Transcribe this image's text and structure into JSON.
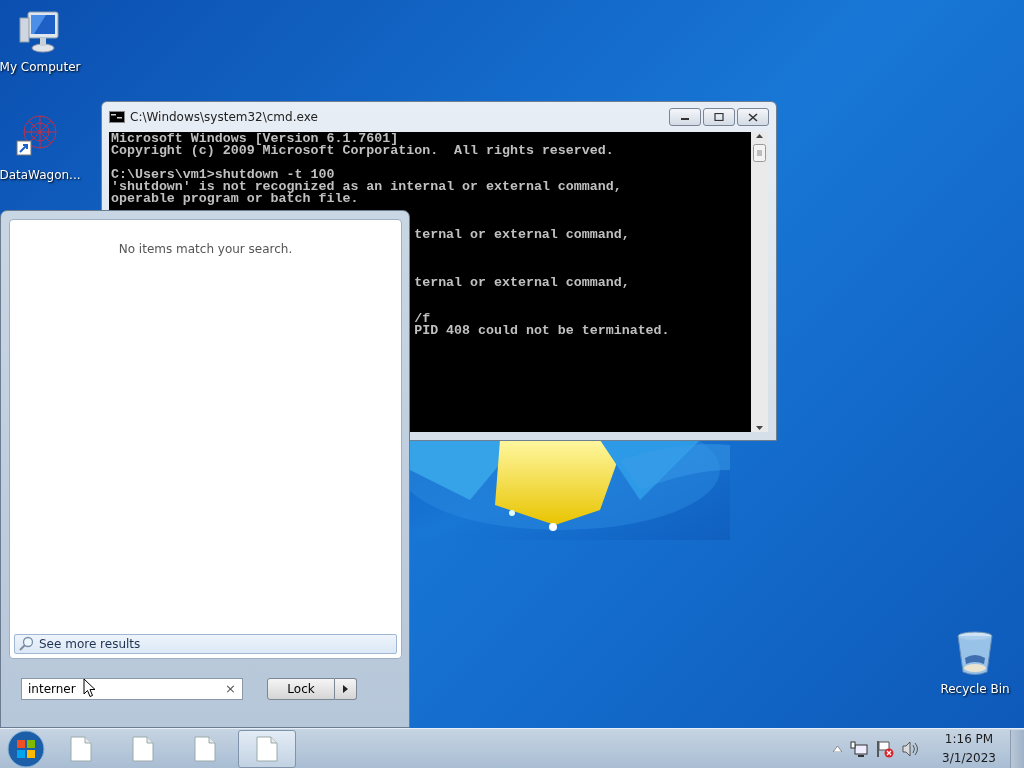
{
  "desktop_icons": [
    {
      "label": "My Computer",
      "kind": "computer"
    },
    {
      "label": "DataWagon...",
      "kind": "shortcut"
    },
    {
      "label": "Recycle Bin",
      "kind": "recycle"
    }
  ],
  "console_window": {
    "title": "C:\\Windows\\system32\\cmd.exe",
    "lines": [
      {
        "kind": "full",
        "text": "Microsoft Windows [Version 6.1.7601]"
      },
      {
        "kind": "full",
        "text": "Copyright (c) 2009 Microsoft Corporation.  All rights reserved."
      },
      {
        "kind": "blank"
      },
      {
        "kind": "full",
        "text": "C:\\Users\\vm1>shutdown -t 100"
      },
      {
        "kind": "full",
        "text": "'shutdown' is not recognized as an internal or external command,"
      },
      {
        "kind": "full",
        "text": "operable program or batch file."
      },
      {
        "kind": "blank"
      },
      {
        "kind": "blank"
      },
      {
        "kind": "tail",
        "text": "ternal or external command,"
      },
      {
        "kind": "blank"
      },
      {
        "kind": "blank"
      },
      {
        "kind": "blank"
      },
      {
        "kind": "tail",
        "text": "ternal or external command,"
      },
      {
        "kind": "blank"
      },
      {
        "kind": "blank"
      },
      {
        "kind": "tail",
        "text": "/f"
      },
      {
        "kind": "tail",
        "text": "PID 408 could not be terminated."
      }
    ]
  },
  "start_menu": {
    "message": "No items match your search.",
    "see_more": "See more results",
    "search": {
      "value": "interner"
    },
    "clear": "×",
    "power_button": "Lock"
  },
  "taskbar": {
    "buttons": [
      {
        "selected": false
      },
      {
        "selected": false
      },
      {
        "selected": false
      },
      {
        "selected": true
      }
    ],
    "tray": {
      "time": "1:16 PM",
      "date": "3/1/2023"
    }
  }
}
